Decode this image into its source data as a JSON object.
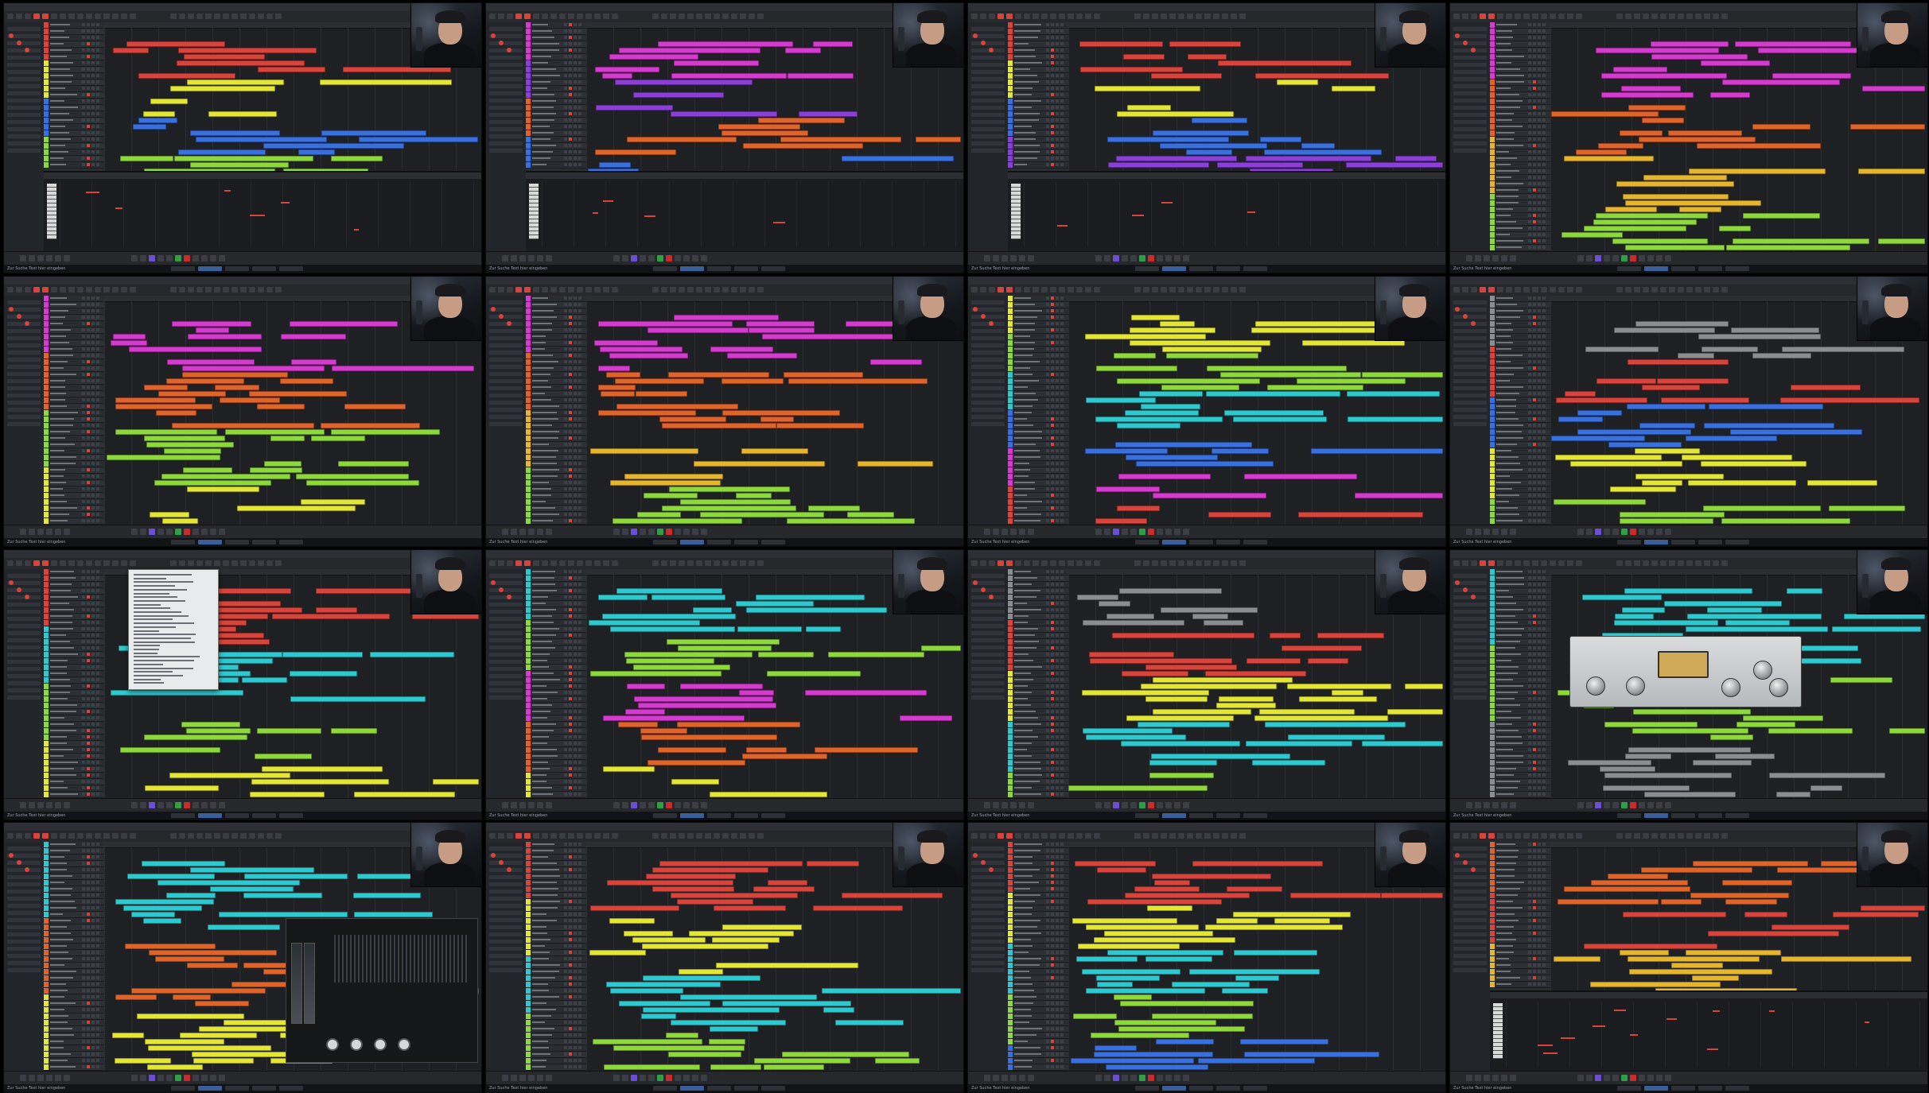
{
  "app": {
    "menu_items": [
      "",
      "File",
      "Edit",
      "Project",
      "Audio",
      "MIDI",
      "Scores",
      "Media",
      "Transport",
      "Studio",
      "Workspaces",
      "Window",
      "VST Cloud",
      "Help"
    ],
    "taskbar_label": "Zur Suche Text hier eingeben"
  },
  "colors": {
    "red": "#d8433b",
    "magenta": "#d63ad0",
    "yellow": "#e4e635",
    "lime": "#8fd83c",
    "cyan": "#2ec9cf",
    "orange": "#e0632a",
    "blue": "#3a6fe0",
    "purple": "#8b3fd8",
    "pink": "#e0558a",
    "gold": "#e4b52d",
    "grey": "#8a8d92"
  },
  "frames": [
    {
      "id": 1,
      "variant": "standard",
      "lower_editor": true,
      "lower_type": "key-editor",
      "icon": "webcam-overlay"
    },
    {
      "id": 2,
      "variant": "standard",
      "lower_editor": true,
      "lower_type": "key-editor"
    },
    {
      "id": 3,
      "variant": "standard",
      "lower_editor": true,
      "lower_type": "key-editor"
    },
    {
      "id": 4,
      "variant": "standard",
      "lower_editor": false
    },
    {
      "id": 5,
      "variant": "standard",
      "lower_editor": false
    },
    {
      "id": 6,
      "variant": "standard",
      "lower_editor": false
    },
    {
      "id": 7,
      "variant": "standard",
      "lower_editor": false
    },
    {
      "id": 8,
      "variant": "standard",
      "lower_editor": false
    },
    {
      "id": 9,
      "variant": "context-menu",
      "lower_editor": false
    },
    {
      "id": 10,
      "variant": "standard",
      "lower_editor": false
    },
    {
      "id": 11,
      "variant": "standard",
      "lower_editor": false
    },
    {
      "id": 12,
      "variant": "plugin-compressor",
      "lower_editor": false
    },
    {
      "id": 13,
      "variant": "plugin-ozone",
      "lower_editor": false
    },
    {
      "id": 14,
      "variant": "standard",
      "lower_editor": false
    },
    {
      "id": 15,
      "variant": "standard",
      "lower_editor": false
    },
    {
      "id": 16,
      "variant": "standard",
      "lower_editor": true,
      "lower_type": "key-editor"
    }
  ]
}
